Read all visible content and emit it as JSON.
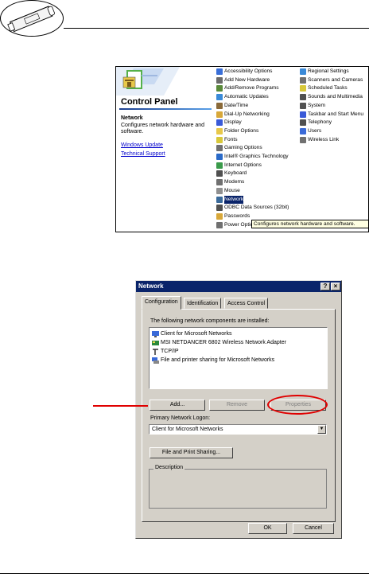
{
  "control_panel": {
    "title": "Control Panel",
    "selected_name": "Network",
    "selected_description": "Configures network hardware and software.",
    "links": [
      "Windows Update",
      "Technical Support"
    ],
    "items_col1": [
      {
        "label": "Accessibility Options",
        "color": "#3a6fd8"
      },
      {
        "label": "Add New Hardware",
        "color": "#6b6b6b"
      },
      {
        "label": "Add/Remove Programs",
        "color": "#5a8a3a"
      },
      {
        "label": "Automatic Updates",
        "color": "#3a8ad8"
      },
      {
        "label": "Date/Time",
        "color": "#8a6a3a"
      },
      {
        "label": "Dial-Up Networking",
        "color": "#d8a83a"
      },
      {
        "label": "Display",
        "color": "#3a5ad8"
      },
      {
        "label": "Folder Options",
        "color": "#e8c84a"
      },
      {
        "label": "Fonts",
        "color": "#d8c83a"
      },
      {
        "label": "Gaming Options",
        "color": "#707070"
      },
      {
        "label": "Intel® Graphics Technology",
        "color": "#2a6ac8"
      },
      {
        "label": "Internet Options",
        "color": "#3a9a4a"
      },
      {
        "label": "Keyboard",
        "color": "#505050"
      },
      {
        "label": "Modems",
        "color": "#707070"
      },
      {
        "label": "Mouse",
        "color": "#909090"
      },
      {
        "label": "Network",
        "color": "#3a6a9a"
      },
      {
        "label": "ODBC Data Sources (32bit)",
        "color": "#505050"
      },
      {
        "label": "Passwords",
        "color": "#d8a83a"
      },
      {
        "label": "Power Options",
        "color": "#707070"
      }
    ],
    "items_col2": [
      {
        "label": "Regional Settings",
        "color": "#3a8ad8"
      },
      {
        "label": "Scanners and Cameras",
        "color": "#707070"
      },
      {
        "label": "Scheduled Tasks",
        "color": "#d8c83a"
      },
      {
        "label": "Sounds and Multimedia",
        "color": "#505050"
      },
      {
        "label": "System",
        "color": "#505050"
      },
      {
        "label": "Taskbar and Start Menu",
        "color": "#3a5ad8"
      },
      {
        "label": "Telephony",
        "color": "#505050"
      },
      {
        "label": "Users",
        "color": "#3a6ad8"
      },
      {
        "label": "Wireless Link",
        "color": "#707070"
      }
    ],
    "tooltip": "Configures network hardware and software."
  },
  "dialog": {
    "title": "Network",
    "help_button": "?",
    "close_button": "×",
    "tabs": [
      "Configuration",
      "Identification",
      "Access Control"
    ],
    "components_label": "The following network components are installed:",
    "components": [
      {
        "label": "Client for Microsoft Networks",
        "icon": "client-icon"
      },
      {
        "label": "MSI NETDANCER 6802 Wireless Network Adapter",
        "icon": "adapter-icon"
      },
      {
        "label": "TCP/IP",
        "icon": "protocol-icon"
      },
      {
        "label": "File and printer sharing for Microsoft Networks",
        "icon": "service-icon"
      }
    ],
    "add_button": "Add...",
    "remove_button": "Remove",
    "properties_button": "Properties",
    "logon_label": "Primary Network Logon:",
    "logon_value": "Client for Microsoft Networks",
    "file_print_button": "File and Print Sharing...",
    "description_label": "Description",
    "ok_button": "OK",
    "cancel_button": "Cancel"
  },
  "colors": {
    "titlebar": "#0a246a",
    "annotation": "#e00000",
    "dialog_face": "#d4d0c8"
  }
}
